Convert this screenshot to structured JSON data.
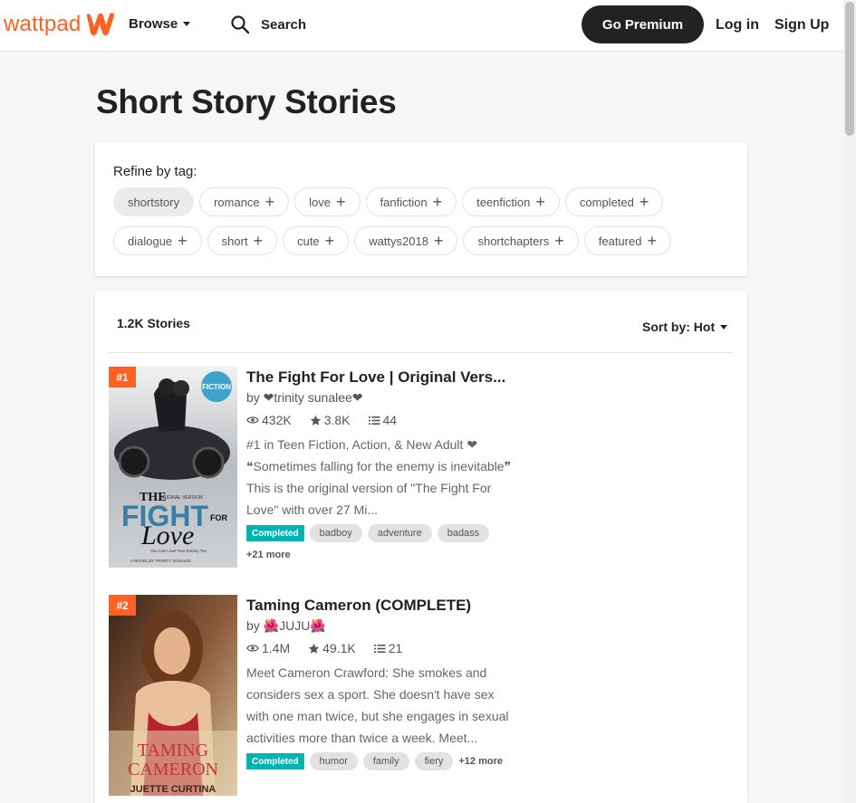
{
  "header": {
    "logo_text": "wattpad",
    "browse_label": "Browse",
    "search_label": "Search",
    "premium_label": "Go Premium",
    "login_label": "Log in",
    "signup_label": "Sign Up",
    "brand_color": "#ff6122"
  },
  "page": {
    "title": "Short Story Stories"
  },
  "refine": {
    "label": "Refine by tag:",
    "tags_row1": [
      "shortstory",
      "romance",
      "love",
      "fanfiction",
      "teenfiction",
      "completed"
    ],
    "tags_row2": [
      "dialogue",
      "short",
      "cute",
      "wattys2018",
      "shortchapters",
      "featured"
    ]
  },
  "list": {
    "count": "1.2K Stories",
    "sort_label": "Sort by: Hot"
  },
  "stories": [
    {
      "rank": "#1",
      "title": "The Fight For Love | Original Vers...",
      "author": "by ❤trinity sunalee❤",
      "reads": "432K",
      "votes": "3.8K",
      "parts": "44",
      "description": "#1 in Teen Fiction, Action, & New Adult ❤ ❝Sometimes falling for the enemy is inevitable❞ This is the original version of \"The Fight For Love\" with over 27 Mi...",
      "completed": "Completed",
      "tags": [
        "badboy",
        "adventure",
        "badass"
      ],
      "more": "+21 more",
      "cover": {
        "line1": "THE",
        "line2": "ORIGINAL VERSION",
        "line3": "FIGHT",
        "line4": "FOR",
        "line5": "Love",
        "line6": "You Can Love Your Enemy Too",
        "line7": "A NOVEL BY TRINITY SUNALEE",
        "sticker": "FICTION"
      }
    },
    {
      "rank": "#2",
      "title": "Taming Cameron (COMPLETE)",
      "author_prefix": "by ",
      "author_name": "JUJU",
      "reads": "1.4M",
      "votes": "49.1K",
      "parts": "21",
      "description": "Meet Cameron Crawford: She smokes and considers sex a sport. She doesn't have sex with one man twice, but she engages in sexual activities more than twice a week. Meet...",
      "completed": "Completed",
      "tags": [
        "humor",
        "family",
        "fiery"
      ],
      "more": "+12 more",
      "cover": {
        "line1": "TAMING",
        "line2": "CAMERON",
        "line3": "JUETTE CURTINA"
      }
    }
  ]
}
